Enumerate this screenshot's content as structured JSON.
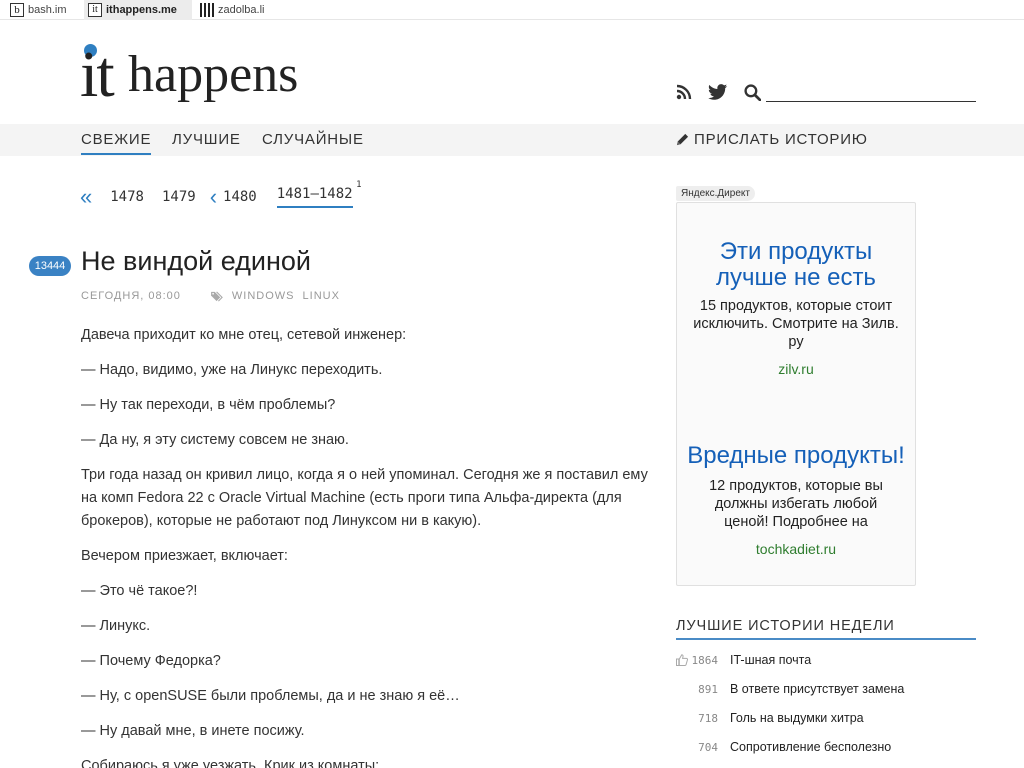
{
  "sites": [
    {
      "icon": "b",
      "name": "bash.im"
    },
    {
      "icon": "it",
      "name": "ithappens.me"
    },
    {
      "icon": "",
      "name": "zadolba.li"
    }
  ],
  "logo": {
    "it": "it",
    "happens": "happens"
  },
  "search": {
    "placeholder": ""
  },
  "nav": {
    "items": [
      "СВЕЖИЕ",
      "ЛУЧШИЕ",
      "СЛУЧАЙНЫЕ"
    ],
    "submit": "ПРИСЛАТЬ ИСТОРИЮ"
  },
  "pager": {
    "prev_all": "«",
    "pages": [
      "1478",
      "1479"
    ],
    "prev": "‹",
    "page_prev": "1480",
    "current": "1481–1482",
    "current_sup": "1"
  },
  "story": {
    "number": "13444",
    "title": "Не виндой единой",
    "date": "СЕГОДНЯ, 08:00",
    "tags": [
      "WINDOWS",
      "LINUX"
    ],
    "paragraphs": [
      "Давеча приходит ко мне отец, сетевой инженер:",
      "— Надо, видимо, уже на Линукс переходить.",
      "— Ну так переходи, в чём проблемы?",
      "— Да ну, я эту систему совсем не знаю.",
      "Три года назад он кривил лицо, когда я о ней упоминал. Сегодня же я поставил ему на комп Fedora 22 с Oracle Virtual Machine (есть проги типа Альфа-директа (для брокеров), которые не работают под Линуксом ни в какую).",
      "Вечером приезжает, включает:",
      "— Это чё такое?!",
      "— Линукс.",
      "— Почему Федорка?",
      "— Ну, с openSUSE были проблемы, да и не знаю я её…",
      "— Ну давай мне, в инете посижу.",
      "Собираюсь я уже уезжать. Крик из комнаты:"
    ]
  },
  "ad": {
    "label": "Яндекс.Директ",
    "items": [
      {
        "title": "Эти продукты лучше не есть",
        "desc": "15 продуктов, которые стоит исключить. Смотрите на Зилв. ру",
        "url": "zilv.ru"
      },
      {
        "title": "Вредные продукты!",
        "desc": "12 продуктов, которые вы должны избегать любой ценой! Подробнее на",
        "url": "tochkadiet.ru"
      }
    ]
  },
  "best": {
    "heading": "ЛУЧШИЕ ИСТОРИИ НЕДЕЛИ",
    "rows": [
      {
        "count": "1864",
        "title": "IT-шная почта"
      },
      {
        "count": "891",
        "title": "В ответе присутствует замена"
      },
      {
        "count": "718",
        "title": "Голь на выдумки хитра"
      },
      {
        "count": "704",
        "title": "Сопротивление бесполезно"
      }
    ]
  },
  "colors": {
    "accent": "#2f7fc1",
    "ad_title": "#1560b8",
    "ad_url": "#2f7d2f"
  }
}
